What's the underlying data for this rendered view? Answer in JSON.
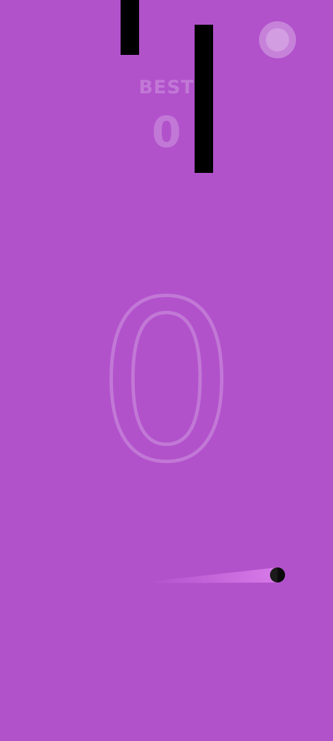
{
  "game": {
    "best_label": "BEST",
    "best_value": "0",
    "current_score": "0"
  },
  "colors": {
    "background": "#b152cb",
    "pipe": "#000000",
    "ball": "#1a1a1a",
    "trail": "#d77ae8"
  },
  "icons": {
    "pause": "circle-button-icon"
  }
}
